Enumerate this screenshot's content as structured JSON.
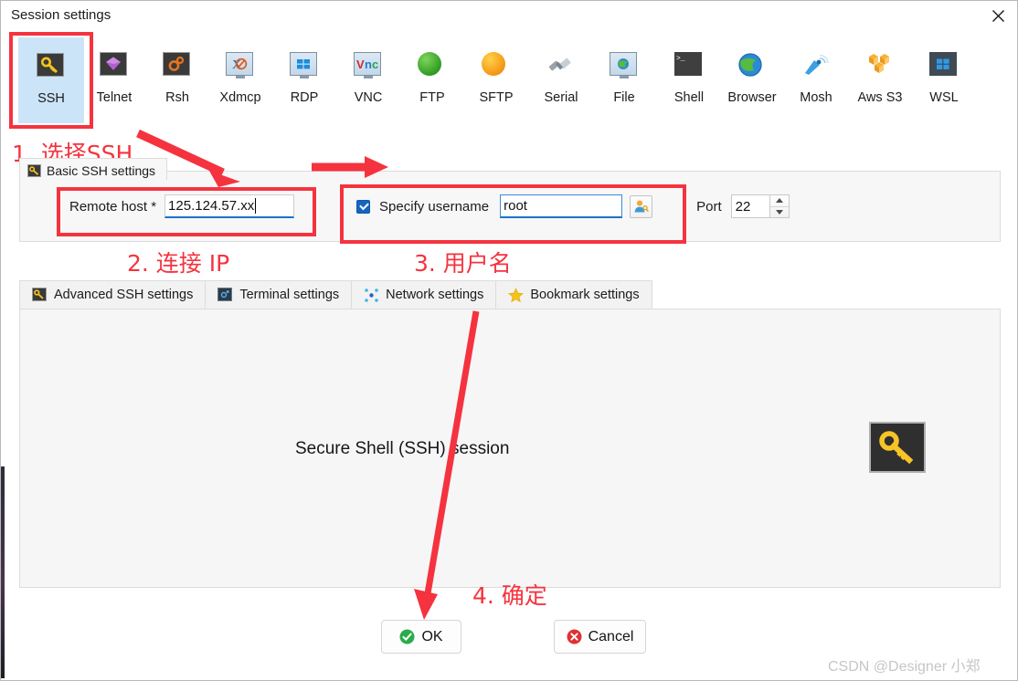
{
  "window": {
    "title": "Session settings",
    "close_icon": "close-icon"
  },
  "toolbar": {
    "protocols": [
      {
        "label": "SSH",
        "icon": "key-icon",
        "selected": true
      },
      {
        "label": "Telnet",
        "icon": "telnet-gem-icon",
        "selected": false
      },
      {
        "label": "Rsh",
        "icon": "rsh-gears-icon",
        "selected": false
      },
      {
        "label": "Xdmcp",
        "icon": "xdmcp-monitor-icon",
        "selected": false
      },
      {
        "label": "RDP",
        "icon": "rdp-monitor-icon",
        "selected": false
      },
      {
        "label": "VNC",
        "icon": "vnc-monitor-icon",
        "selected": false
      },
      {
        "label": "FTP",
        "icon": "ftp-globe-green-icon",
        "selected": false
      },
      {
        "label": "SFTP",
        "icon": "sftp-globe-orange-icon",
        "selected": false
      },
      {
        "label": "Serial",
        "icon": "serial-plug-icon",
        "selected": false
      },
      {
        "label": "File",
        "icon": "file-monitor-globe-icon",
        "selected": false
      },
      {
        "label": "Shell",
        "icon": "shell-prompt-icon",
        "selected": false
      },
      {
        "label": "Browser",
        "icon": "browser-globe-icon",
        "selected": false
      },
      {
        "label": "Mosh",
        "icon": "mosh-satellite-icon",
        "selected": false
      },
      {
        "label": "Aws S3",
        "icon": "aws-s3-buckets-icon",
        "selected": false
      },
      {
        "label": "WSL",
        "icon": "wsl-windows-icon",
        "selected": false
      }
    ]
  },
  "basic_group": {
    "tab_label": "Basic SSH settings",
    "tab_icon": "key-icon",
    "remote_host": {
      "label": "Remote host *",
      "value": "125.124.57.xx"
    },
    "specify_username": {
      "label": "Specify username",
      "checked": true,
      "value": "root",
      "browse_icon": "user-key-icon"
    },
    "port": {
      "label": "Port",
      "value": "22",
      "up_icon": "chevron-up-icon",
      "down_icon": "chevron-down-icon"
    }
  },
  "tabs": [
    {
      "label": "Advanced SSH settings",
      "icon": "key-icon",
      "active": false
    },
    {
      "label": "Terminal settings",
      "icon": "terminal-icon",
      "active": false
    },
    {
      "label": "Network settings",
      "icon": "network-nodes-icon",
      "active": false
    },
    {
      "label": "Bookmark settings",
      "icon": "star-icon",
      "active": false
    }
  ],
  "panel": {
    "caption": "Secure Shell (SSH) session",
    "big_icon": "key-icon"
  },
  "footer": {
    "ok_label": "OK",
    "ok_icon": "check-circle-icon",
    "cancel_label": "Cancel",
    "cancel_icon": "x-circle-icon"
  },
  "annotations": {
    "color": "#f5333f",
    "step1": "1. 选择SSH",
    "step2": "2. 连接 IP",
    "step3": "3. 用户名",
    "step4": "4. 确定"
  },
  "watermark": "CSDN @Designer 小郑"
}
